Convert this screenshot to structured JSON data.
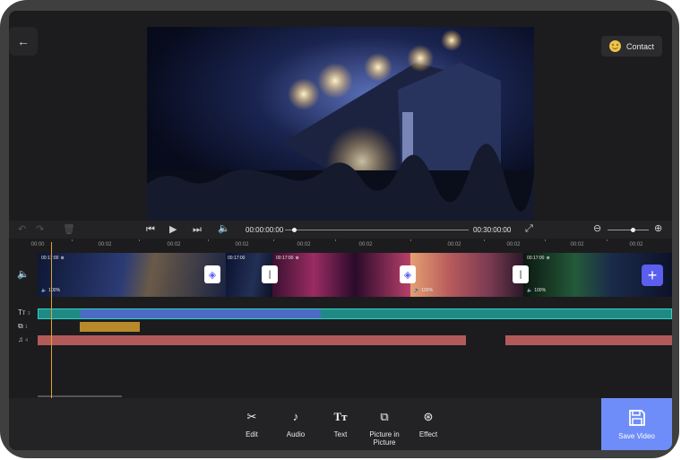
{
  "header": {
    "back_label": "←",
    "contact_label": "Contact"
  },
  "player": {
    "current_time": "00:00:00:00",
    "total_time": "00:30:00:00",
    "progress": 0.05,
    "zoom_level": 0.6
  },
  "ruler": {
    "labels": [
      "00:00",
      "00:02",
      "00:02",
      "00:02",
      "00:02",
      "00:02",
      "00:02",
      "00:02",
      "00:02",
      "00:02"
    ]
  },
  "clips": [
    {
      "duration": "00:17:00",
      "volume": "100%"
    },
    {
      "duration": "00:17:00",
      "volume": ""
    },
    {
      "duration": "00:17:00",
      "volume": ""
    },
    {
      "duration": "",
      "volume": "100%"
    },
    {
      "duration": "00:17:00",
      "volume": "100%"
    }
  ],
  "tracks": {
    "text_badge": "3",
    "pip_badge": "1",
    "audio_badge": "4"
  },
  "toolbar": {
    "edit_label": "Edit",
    "audio_label": "Audio",
    "text_label": "Text",
    "pip_label": "Picture in Picture",
    "effect_label": "Effect",
    "save_label": "Save Video"
  },
  "colors": {
    "accent": "#6e8df8",
    "text_track": "#1f8a84",
    "text_clip": "#4b6bc6",
    "pip_clip": "#b8892a",
    "audio_clip": "#b25a5a",
    "playhead": "#e0a32c"
  }
}
